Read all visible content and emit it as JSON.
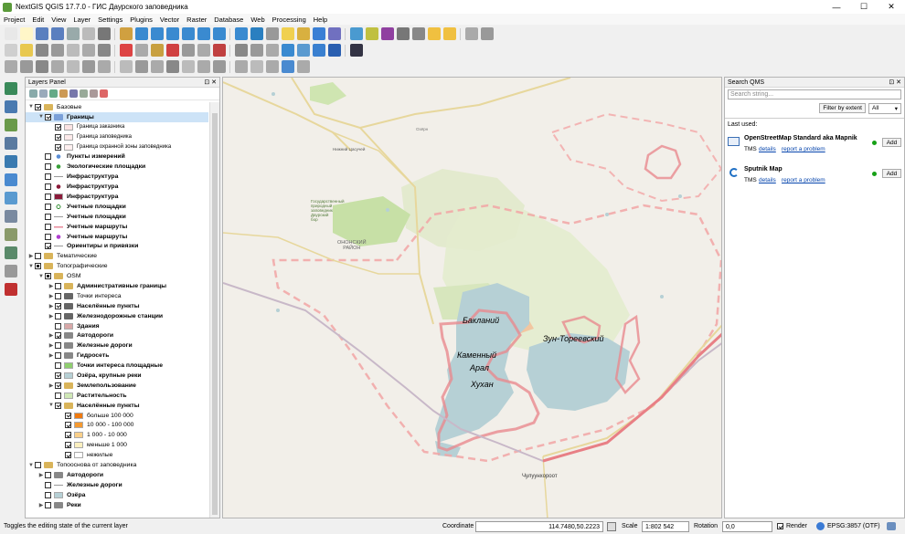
{
  "window": {
    "title": "NextGIS QGIS 17.7.0 - ГИС Даурского заповедника",
    "minimize": "—",
    "maximize": "☐",
    "close": "✕"
  },
  "menu": [
    "Project",
    "Edit",
    "View",
    "Layer",
    "Settings",
    "Plugins",
    "Vector",
    "Raster",
    "Database",
    "Web",
    "Processing",
    "Help"
  ],
  "layers_panel": {
    "title": "Layers Panel",
    "controls": "⊡ ✕"
  },
  "layers": [
    {
      "indent": 0,
      "arrow": "▼",
      "check": "chk",
      "icon": "group",
      "label": "Базовые",
      "bold": false
    },
    {
      "indent": 1,
      "arrow": "▼",
      "check": "chk",
      "icon": "group-sel",
      "label": "Границы",
      "bold": true,
      "selected": true
    },
    {
      "indent": 2,
      "arrow": "",
      "check": "chk",
      "sym": "#fbe3e3",
      "label": "Граница заказника",
      "bold": false,
      "small": true
    },
    {
      "indent": 2,
      "arrow": "",
      "check": "chk",
      "sym": "#fdeaea",
      "label": "Граница заповедника",
      "bold": false,
      "small": true
    },
    {
      "indent": 2,
      "arrow": "",
      "check": "chk",
      "sym": "#fff0f0",
      "label": "Граница охранной зоны заповедника",
      "bold": false,
      "small": true
    },
    {
      "indent": 1,
      "arrow": "",
      "check": "",
      "sym": "dot-blue",
      "label": "Пункты измерений",
      "bold": true
    },
    {
      "indent": 1,
      "arrow": "",
      "check": "",
      "sym": "dot-green",
      "label": "Экологические площадки",
      "bold": true
    },
    {
      "indent": 1,
      "arrow": "",
      "check": "",
      "sym": "line-grey",
      "label": "Инфраструктура",
      "bold": true
    },
    {
      "indent": 1,
      "arrow": "",
      "check": "",
      "sym": "dot-maroon",
      "label": "Инфраструктура",
      "bold": true
    },
    {
      "indent": 1,
      "arrow": "",
      "check": "",
      "sym": "sq-maroon",
      "label": "Инфраструктура",
      "bold": true
    },
    {
      "indent": 1,
      "arrow": "",
      "check": "",
      "sym": "dot-hollow",
      "label": "Учетные площадки",
      "bold": true
    },
    {
      "indent": 1,
      "arrow": "",
      "check": "",
      "sym": "line-grey",
      "label": "Учетные площадки",
      "bold": true
    },
    {
      "indent": 1,
      "arrow": "",
      "check": "",
      "sym": "line-pink",
      "label": "Учетные маршруты",
      "bold": true
    },
    {
      "indent": 1,
      "arrow": "",
      "check": "",
      "sym": "dot-purple",
      "label": "Учетные маршруты",
      "bold": true
    },
    {
      "indent": 1,
      "arrow": "",
      "check": "chk",
      "sym": "line-grey",
      "label": "Ориентиры и привязки",
      "bold": true
    },
    {
      "indent": 0,
      "arrow": "▶",
      "check": "",
      "icon": "group",
      "label": "Тематические",
      "bold": false
    },
    {
      "indent": 0,
      "arrow": "▼",
      "check": "part",
      "icon": "group",
      "label": "Топографические",
      "bold": false
    },
    {
      "indent": 1,
      "arrow": "▼",
      "check": "part",
      "icon": "group",
      "label": "OSM",
      "bold": false
    },
    {
      "indent": 2,
      "arrow": "▶",
      "check": "",
      "icon": "group",
      "label": "Административные границы",
      "bold": true
    },
    {
      "indent": 2,
      "arrow": "▶",
      "check": "",
      "icon": "poi",
      "label": "Точки интереса",
      "bold": false
    },
    {
      "indent": 2,
      "arrow": "▶",
      "check": "chk",
      "icon": "poi",
      "label": "Населённые пункты",
      "bold": true
    },
    {
      "indent": 2,
      "arrow": "▶",
      "check": "",
      "icon": "poi",
      "label": "Железнодорожные станции",
      "bold": true
    },
    {
      "indent": 2,
      "arrow": "",
      "check": "",
      "sym": "sq-rose",
      "label": "Здания",
      "bold": true
    },
    {
      "indent": 2,
      "arrow": "▶",
      "check": "chk",
      "icon": "line",
      "label": "Автодороги",
      "bold": true
    },
    {
      "indent": 2,
      "arrow": "▶",
      "check": "",
      "icon": "line",
      "label": "Железные дороги",
      "bold": true
    },
    {
      "indent": 2,
      "arrow": "▶",
      "check": "",
      "icon": "line",
      "label": "Гидросеть",
      "bold": true
    },
    {
      "indent": 2,
      "arrow": "",
      "check": "",
      "sym": "sq-green",
      "label": "Точки интереса площадные",
      "bold": true
    },
    {
      "indent": 2,
      "arrow": "",
      "check": "chk",
      "sym": "sq-lightblue",
      "label": "Озёра, крупные реки",
      "bold": true
    },
    {
      "indent": 2,
      "arrow": "▶",
      "check": "chk",
      "icon": "group",
      "label": "Землепользование",
      "bold": true
    },
    {
      "indent": 2,
      "arrow": "",
      "check": "",
      "sym": "sq-lightgreen",
      "label": "Растительность",
      "bold": true
    },
    {
      "indent": 2,
      "arrow": "▼",
      "check": "chk",
      "icon": "group",
      "label": "Населённые пункты",
      "bold": true
    },
    {
      "indent": 3,
      "arrow": "",
      "check": "chk",
      "sym": "sq-orange",
      "label": "больше 100 000",
      "bold": false
    },
    {
      "indent": 3,
      "arrow": "",
      "check": "chk",
      "sym": "sq-orange2",
      "label": "10 000 - 100 000",
      "bold": false
    },
    {
      "indent": 3,
      "arrow": "",
      "check": "chk",
      "sym": "sq-peach",
      "label": "1 000 - 10 000",
      "bold": false
    },
    {
      "indent": 3,
      "arrow": "",
      "check": "chk",
      "sym": "sq-cream",
      "label": "меньше 1 000",
      "bold": false
    },
    {
      "indent": 3,
      "arrow": "",
      "check": "chk",
      "sym": "sq-white",
      "label": "нежилые",
      "bold": false
    },
    {
      "indent": 0,
      "arrow": "▼",
      "check": "",
      "icon": "group",
      "label": "Топооснова от заповедника",
      "bold": false
    },
    {
      "indent": 1,
      "arrow": "▶",
      "check": "",
      "icon": "line",
      "label": "Автодороги",
      "bold": true
    },
    {
      "indent": 1,
      "arrow": "",
      "check": "",
      "sym": "line-grey",
      "label": "Железные дороги",
      "bold": true
    },
    {
      "indent": 1,
      "arrow": "",
      "check": "",
      "sym": "sq-lightblue",
      "label": "Озёра",
      "bold": true
    },
    {
      "indent": 1,
      "arrow": "▶",
      "check": "",
      "icon": "line",
      "label": "Реки",
      "bold": true
    }
  ],
  "map": {
    "labels": {
      "baklaniy": "Бакланий",
      "zun": "Зун-Тореевский",
      "kamenny": "Каменный",
      "aral": "Арал",
      "khukhan": "Хухан",
      "district": "ОНОНСКИЙ\nРАЙОН",
      "village_n": "Нижний Цасучей",
      "reserve": "Государственный\nприродный\nзаповедник\nДаурский\nбор",
      "chuluun": "Чулуунхороот",
      "ozer": "Озёрн"
    }
  },
  "qms": {
    "title": "Search QMS",
    "controls": "⊡ ✕",
    "placeholder": "Search string...",
    "filter_button": "Filter by extent",
    "filter_select": "All",
    "last_used": "Last used:",
    "items": [
      {
        "name": "OpenStreetMap Standard aka Mapnik",
        "type": "TMS",
        "details": "details",
        "report": "report a problem",
        "add": "Add"
      },
      {
        "name": "Sputnik Map",
        "type": "TMS",
        "details": "details",
        "report": "report a problem",
        "add": "Add"
      }
    ]
  },
  "status": {
    "message": "Toggles the editing state of the current layer",
    "coord_label": "Coordinate",
    "coord": "114.7480,50.2223",
    "scale_label": "Scale",
    "scale": "1:802 542",
    "rotation_label": "Rotation",
    "rotation": "0,0",
    "render_label": "Render",
    "crs": "EPSG:3857 (OTF)"
  }
}
